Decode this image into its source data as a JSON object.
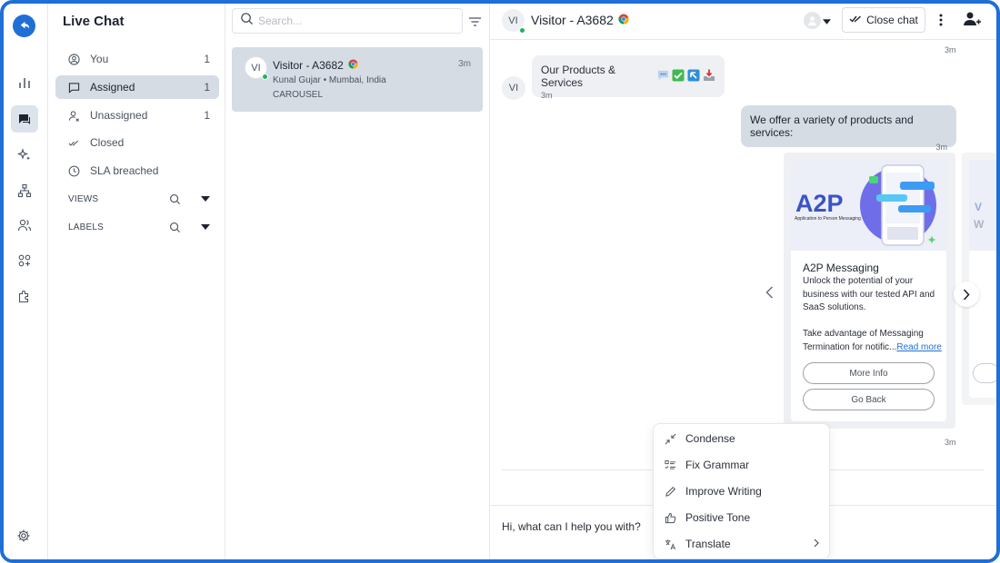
{
  "sidebar": {
    "title": "Live Chat",
    "items": [
      {
        "label": "You",
        "count": "1"
      },
      {
        "label": "Assigned",
        "count": "1"
      },
      {
        "label": "Unassigned",
        "count": "1"
      },
      {
        "label": "Closed",
        "count": ""
      },
      {
        "label": "SLA breached",
        "count": ""
      }
    ],
    "sections": [
      {
        "label": "VIEWS"
      },
      {
        "label": "LABELS"
      }
    ]
  },
  "conversations": {
    "search_placeholder": "Search...",
    "items": [
      {
        "initials": "VI",
        "name": "Visitor - A3682",
        "time": "3m",
        "subtitle": "Kunal Gujar • Mumbai, India",
        "tag": "CAROUSEL"
      }
    ]
  },
  "chat": {
    "header": {
      "initials": "VI",
      "name": "Visitor - A3682",
      "close_label": "Close chat"
    },
    "top_time": "3m",
    "messages": [
      {
        "direction": "in",
        "initials": "VI",
        "text": "Our Products & Services",
        "time": "3m"
      },
      {
        "direction": "out",
        "text": "We offer a variety of products and services:",
        "time": "3m"
      }
    ],
    "carousel": {
      "time": "3m",
      "card": {
        "image_title": "A2P",
        "image_subtitle": "Application to Person Messaging",
        "title": "A2P Messaging",
        "desc": "Unlock the potential of your business with our tested API and SaaS solutions.",
        "desc2": "Take advantage of Messaging Termination for notific...",
        "read_more": "Read more",
        "buttons": [
          "More Info",
          "Go Back"
        ]
      },
      "peek_letters": [
        "V",
        "W"
      ]
    },
    "composer_text": "Hi, what can I help you with?",
    "ai_menu": [
      {
        "label": "Condense",
        "icon": "condense-icon"
      },
      {
        "label": "Fix Grammar",
        "icon": "grammar-icon"
      },
      {
        "label": "Improve Writing",
        "icon": "pencil-icon"
      },
      {
        "label": "Positive Tone",
        "icon": "thumbs-up-icon"
      },
      {
        "label": "Translate",
        "icon": "translate-icon"
      }
    ]
  },
  "colors": {
    "accent": "#1f6fd6",
    "active_bg": "#d6dce4",
    "online": "#22b35b"
  }
}
